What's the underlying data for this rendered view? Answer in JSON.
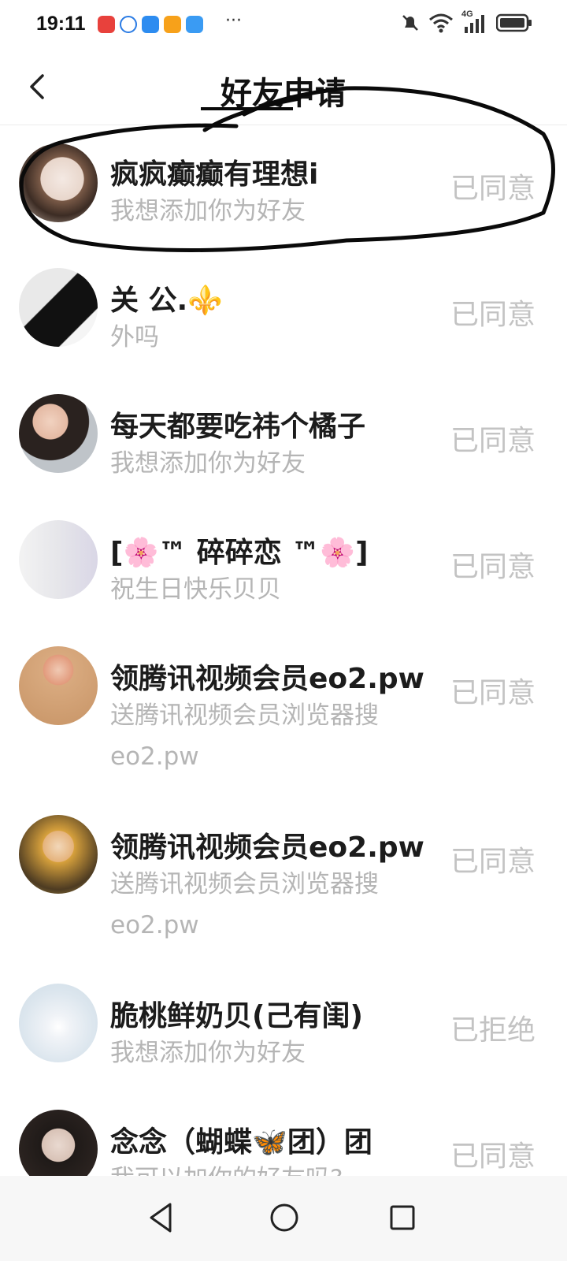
{
  "status_bar": {
    "time": "19:11",
    "more": "···",
    "network": "4G",
    "app_icons": [
      "red-app-icon",
      "blue-app-icon",
      "weather-icon",
      "orange-play-icon",
      "cloud-icon"
    ]
  },
  "header": {
    "title": "好友申请"
  },
  "requests": [
    {
      "name": "疯疯癫癫有理想i",
      "message": "我想添加你为好友",
      "status": "已同意"
    },
    {
      "name": "关 公.⚜️",
      "message": "外吗",
      "status": "已同意"
    },
    {
      "name": "每天都要吃祎个橘子",
      "message": "我想添加你为好友",
      "status": "已同意"
    },
    {
      "name": "[🌸™ 碎碎恋 ™🌸]",
      "message": "祝生日快乐贝贝",
      "status": "已同意"
    },
    {
      "name": "领腾讯视频会员eo2.pw",
      "message": "送腾讯视频会员浏览器搜eo2.pw",
      "status": "已同意"
    },
    {
      "name": "领腾讯视频会员eo2.pw",
      "message": "送腾讯视频会员浏览器搜eo2.pw",
      "status": "已同意"
    },
    {
      "name": "脆桃鲜奶贝(己有闺)",
      "message": "我想添加你为好友",
      "status": "已拒绝"
    },
    {
      "name": "念念（蝴蝶🦋团）团",
      "message": "我可以加你的好友吗?",
      "status": "已同意"
    }
  ],
  "colors": {
    "name": "#1c1c1c",
    "secondary": "#b5b5b5",
    "status": "#c3c3c3"
  }
}
